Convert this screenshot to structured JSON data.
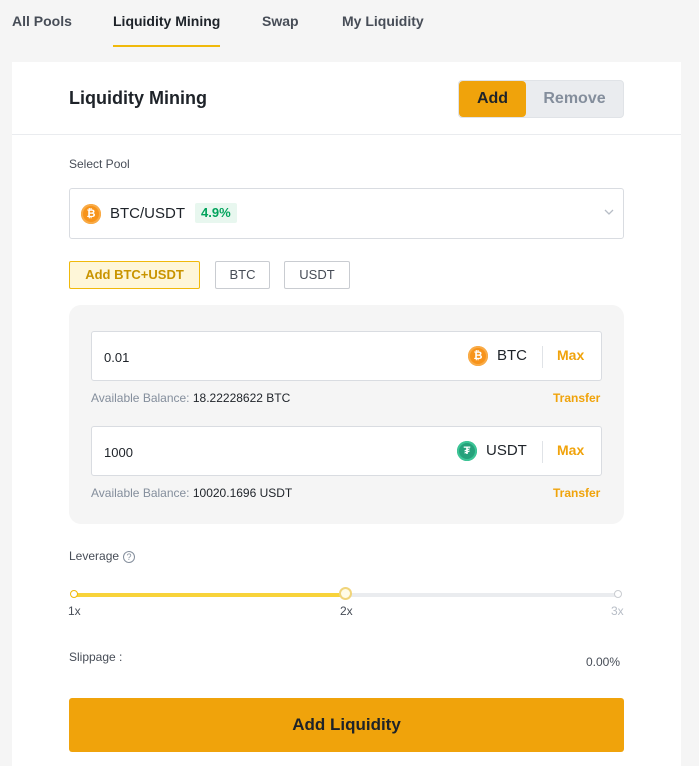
{
  "tabs": [
    {
      "label": "All Pools"
    },
    {
      "label": "Liquidity Mining",
      "active": true
    },
    {
      "label": "Swap"
    },
    {
      "label": "My Liquidity"
    }
  ],
  "header": {
    "title": "Liquidity Mining",
    "add_label": "Add",
    "remove_label": "Remove"
  },
  "pool": {
    "label": "Select Pool",
    "pair": "BTC/USDT",
    "apy": "4.9%"
  },
  "chips": [
    {
      "label": "Add BTC+USDT",
      "active": true
    },
    {
      "label": "BTC"
    },
    {
      "label": "USDT"
    }
  ],
  "inputs": [
    {
      "value": "0.01",
      "symbol": "BTC",
      "max_label": "Max",
      "balance_label": "Available Balance:",
      "balance_value": "18.22228622 BTC",
      "transfer_label": "Transfer"
    },
    {
      "value": "1000",
      "symbol": "USDT",
      "max_label": "Max",
      "balance_label": "Available Balance:",
      "balance_value": "10020.1696 USDT",
      "transfer_label": "Transfer"
    }
  ],
  "leverage": {
    "label": "Leverage",
    "help_glyph": "?",
    "ticks": [
      "1x",
      "2x",
      "3x"
    ],
    "value_fraction": 0.5
  },
  "slippage": {
    "label": "Slippage :",
    "value": "0.00%"
  },
  "cta_label": "Add Liquidity",
  "colors": {
    "accent": "#f0a30b",
    "apy_green": "#02a35c",
    "btc": "#f7931a",
    "usdt": "#26a17b"
  },
  "icons": {
    "btc": "bitcoin-icon",
    "usdt": "tether-icon",
    "dropdown": "chevron-down-icon",
    "help": "question-circle-icon"
  }
}
